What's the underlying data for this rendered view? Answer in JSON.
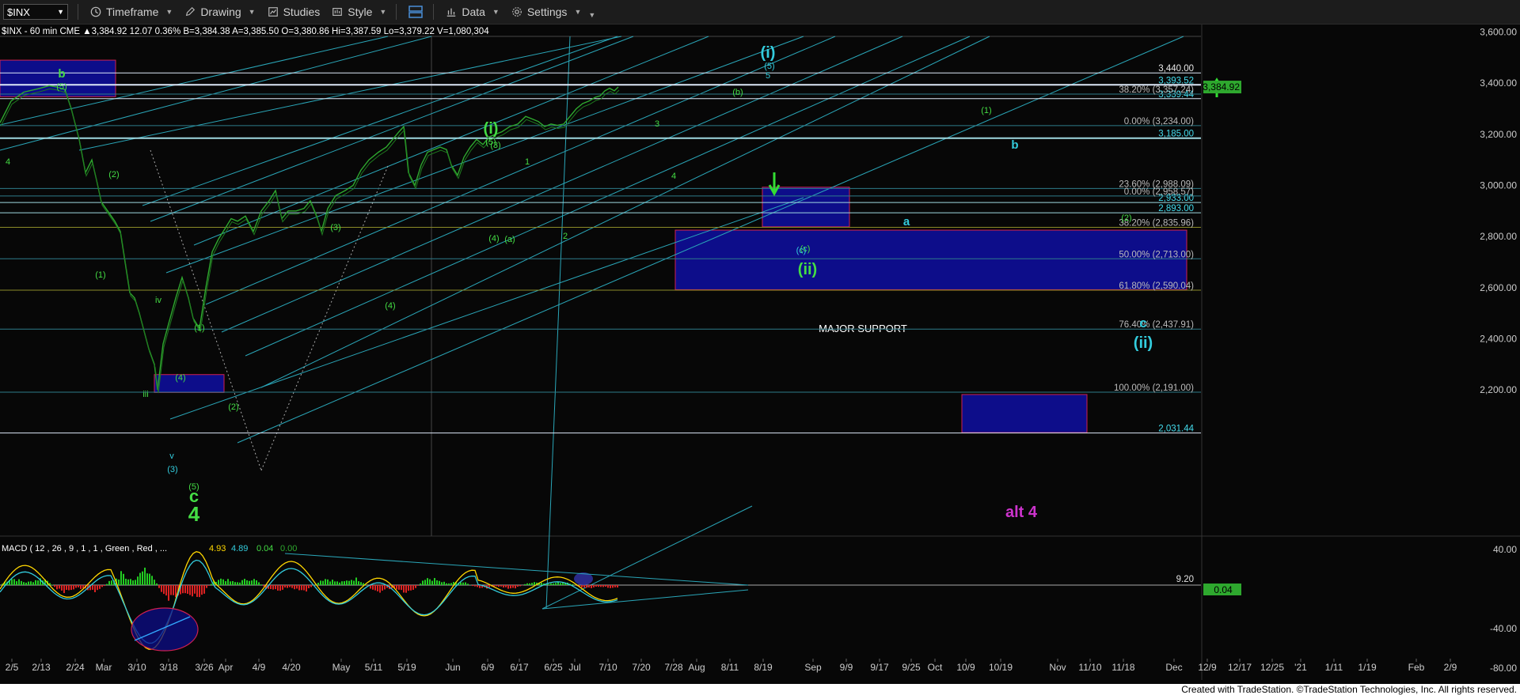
{
  "toolbar": {
    "symbol": "$INX",
    "timeframe": "Timeframe",
    "drawing": "Drawing",
    "studies": "Studies",
    "style": "Style",
    "data": "Data",
    "settings": "Settings"
  },
  "header_line": "$INX - 60 min  CME  ▲3,384.92  12.07  0.36%  B=3,384.38  A=3,385.50  O=3,380.86  Hi=3,387.59  Lo=3,379.22  V=1,080,304",
  "macd_label": "MACD ( 12 , 26 , 9 , 1 , 1 , Green , Red , ...",
  "macd_values": [
    "4.93",
    "4.89",
    "0.04",
    "0.00"
  ],
  "footer": "Created with TradeStation. ©TradeStation Technologies, Inc. All rights reserved.",
  "colors": {
    "background": "#070707",
    "price": "#2ea82e",
    "channel": "#2aa6b8",
    "level": "#e6f2ff",
    "box": "#0d0d8a",
    "box_border": "#d02050",
    "green": "#44dd44",
    "cyan": "#33ccdd",
    "magenta": "#cc33cc"
  },
  "chart_data": {
    "type": "line",
    "title": "$INX - 60 min",
    "ylim": [
      1990,
      3620
    ],
    "y_ticks": [
      "3,600.00",
      "3,400.00",
      "3,200.00",
      "3,000.00",
      "2,800.00",
      "2,600.00",
      "2,400.00",
      "2,200.00"
    ],
    "x_ticks": [
      "2/5",
      "2/13",
      "2/24",
      "Mar",
      "3/10",
      "3/18",
      "3/26",
      "Apr",
      "4/9",
      "4/20",
      "May",
      "5/11",
      "5/19",
      "Jun",
      "6/9",
      "6/17",
      "6/25",
      "Jul",
      "7/10",
      "7/20",
      "7/28",
      "Aug",
      "8/11",
      "8/19",
      "Sep",
      "9/9",
      "9/17",
      "9/25",
      "Oct",
      "10/9",
      "10/19",
      "Nov",
      "11/10",
      "11/18",
      "Dec",
      "12/9",
      "12/17",
      "12/25",
      "'21",
      "1/11",
      "1/19",
      "Feb",
      "2/9"
    ],
    "price_series": [
      [
        0,
        3245
      ],
      [
        14,
        3330
      ],
      [
        30,
        3365
      ],
      [
        48,
        3378
      ],
      [
        62,
        3390
      ],
      [
        72,
        3385
      ],
      [
        82,
        3375
      ],
      [
        90,
        3300
      ],
      [
        100,
        3180
      ],
      [
        108,
        3050
      ],
      [
        116,
        3100
      ],
      [
        122,
        3020
      ],
      [
        128,
        2935
      ],
      [
        136,
        2900
      ],
      [
        145,
        2860
      ],
      [
        152,
        2820
      ],
      [
        158,
        2700
      ],
      [
        164,
        2580
      ],
      [
        170,
        2560
      ],
      [
        176,
        2500
      ],
      [
        182,
        2430
      ],
      [
        188,
        2360
      ],
      [
        195,
        2300
      ],
      [
        199,
        2200
      ],
      [
        206,
        2380
      ],
      [
        214,
        2470
      ],
      [
        222,
        2560
      ],
      [
        230,
        2640
      ],
      [
        238,
        2560
      ],
      [
        244,
        2480
      ],
      [
        252,
        2440
      ],
      [
        260,
        2600
      ],
      [
        268,
        2740
      ],
      [
        276,
        2790
      ],
      [
        284,
        2830
      ],
      [
        292,
        2870
      ],
      [
        300,
        2860
      ],
      [
        310,
        2880
      ],
      [
        320,
        2820
      ],
      [
        330,
        2900
      ],
      [
        340,
        2940
      ],
      [
        348,
        2980
      ],
      [
        356,
        2870
      ],
      [
        364,
        2900
      ],
      [
        374,
        2900
      ],
      [
        384,
        2910
      ],
      [
        392,
        2940
      ],
      [
        400,
        2880
      ],
      [
        406,
        2820
      ],
      [
        414,
        2910
      ],
      [
        424,
        2960
      ],
      [
        436,
        2980
      ],
      [
        446,
        3000
      ],
      [
        456,
        3060
      ],
      [
        466,
        3100
      ],
      [
        478,
        3130
      ],
      [
        488,
        3150
      ],
      [
        496,
        3180
      ],
      [
        504,
        3210
      ],
      [
        510,
        3230
      ],
      [
        516,
        3050
      ],
      [
        524,
        3000
      ],
      [
        532,
        3080
      ],
      [
        540,
        3130
      ],
      [
        548,
        3140
      ],
      [
        556,
        3150
      ],
      [
        564,
        3140
      ],
      [
        570,
        3080
      ],
      [
        578,
        3040
      ],
      [
        586,
        3110
      ],
      [
        594,
        3150
      ],
      [
        602,
        3180
      ],
      [
        610,
        3160
      ],
      [
        618,
        3190
      ],
      [
        626,
        3200
      ],
      [
        634,
        3210
      ],
      [
        644,
        3230
      ],
      [
        654,
        3240
      ],
      [
        664,
        3270
      ],
      [
        672,
        3260
      ],
      [
        680,
        3250
      ],
      [
        688,
        3230
      ],
      [
        696,
        3240
      ],
      [
        704,
        3235
      ],
      [
        712,
        3240
      ],
      [
        720,
        3270
      ],
      [
        728,
        3300
      ],
      [
        736,
        3320
      ],
      [
        744,
        3330
      ],
      [
        752,
        3345
      ],
      [
        758,
        3350
      ],
      [
        764,
        3370
      ],
      [
        770,
        3380
      ],
      [
        776,
        3370
      ],
      [
        781,
        3385
      ]
    ],
    "horizontal_levels": [
      {
        "price": 3440.0,
        "label": "3,440.00"
      },
      {
        "price": 3393.52,
        "label": "3,393.52"
      },
      {
        "price": 3339.44,
        "label": "3,339.44"
      },
      {
        "price": 3185.0,
        "label": "3,185.00"
      },
      {
        "price": 2933.0,
        "label": "2,933.00"
      },
      {
        "price": 2893.0,
        "label": "2,893.00"
      },
      {
        "price": 2031.44,
        "label": "2,031.44"
      }
    ],
    "fib_levels": [
      {
        "price": 3357.24,
        "label": "38.20% (3,357.24)"
      },
      {
        "price": 3234.0,
        "label": "0.00% (3,234.00)"
      },
      {
        "price": 2988.09,
        "label": "23.60% (2,988.09)"
      },
      {
        "price": 2958.57,
        "label": "0.00% (2,958.57)"
      },
      {
        "price": 2835.96,
        "label": "38.20% (2,835.96)"
      },
      {
        "price": 2713.0,
        "label": "50.00% (2,713.00)"
      },
      {
        "price": 2590.04,
        "label": "61.80% (2,590.04)"
      },
      {
        "price": 2437.91,
        "label": "76.40% (2,437.91)"
      },
      {
        "price": 2191.0,
        "label": "100.00% (2,191.00)"
      }
    ],
    "last_price_label": "3,384.92",
    "macd_levels": [
      "40.00",
      "-40.00",
      "-80.00"
    ],
    "macd_value_labels": [
      "9.20",
      "0.04"
    ],
    "zones": [
      {
        "label": "MAJOR SUPPORT",
        "top": 2825,
        "bottom": 2592
      },
      {
        "label": "alt 4",
        "top": 2182,
        "bottom": 2033
      }
    ],
    "wave_labels": {
      "green": [
        "b",
        "(5)",
        "(1)",
        "(2)",
        "(1)",
        "iv",
        "(4)",
        "iii",
        "(1)",
        "(2)",
        "(3)",
        "(4)",
        "(3)",
        "(4)",
        "(i)",
        "(5)",
        "(3)",
        "(4)",
        "(a)",
        "(b)",
        "(c)",
        "(ii)",
        "1",
        "2",
        "3",
        "4",
        "(1)",
        "(2)",
        "c",
        "4",
        "(5)",
        "(3)",
        "v"
      ],
      "cyan": [
        "(i)",
        "(5)",
        "5",
        "b",
        "a",
        "c",
        "(ii)"
      ]
    }
  }
}
